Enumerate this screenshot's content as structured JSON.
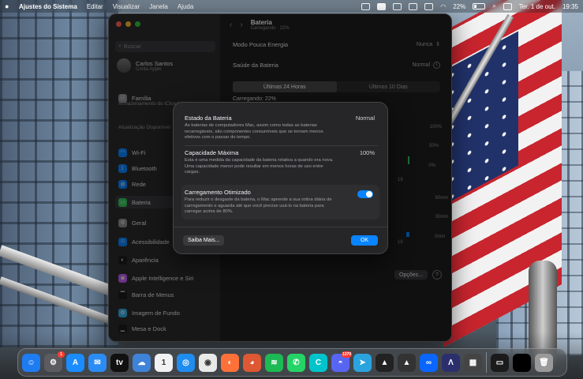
{
  "menubar": {
    "app_name": "Ajustes do Sistema",
    "menus": [
      "Editar",
      "Visualizar",
      "Janela",
      "Ajuda"
    ],
    "battery_percent": "22%",
    "date": "Ter. 1 de out.",
    "time": "19:35"
  },
  "window": {
    "search_placeholder": "Buscar",
    "profile_name": "Carlos Santos",
    "profile_sub": "Conta Apple",
    "family_label": "Família",
    "icloud_note": "Armazenamento do iCloud cheio",
    "update_note": "Atualização Disponível",
    "sidebar_items": [
      {
        "label": "Wi-Fi",
        "icon": "wifi-icon",
        "color": "#0a84ff"
      },
      {
        "label": "Bluetooth",
        "icon": "bluetooth-icon",
        "color": "#0a84ff"
      },
      {
        "label": "Rede",
        "icon": "globe-icon",
        "color": "#0a84ff"
      },
      {
        "label": "Bateria",
        "icon": "battery-icon",
        "color": "#34c759"
      },
      {
        "label": "Geral",
        "icon": "gear-icon",
        "color": "#8e8e93"
      },
      {
        "label": "Acessibilidade",
        "icon": "accessibility-icon",
        "color": "#0a84ff"
      },
      {
        "label": "Aparência",
        "icon": "appearance-icon",
        "color": "#1c1c1e"
      },
      {
        "label": "Apple Intelligence e Siri",
        "icon": "siri-icon",
        "color": "#bf5af2"
      },
      {
        "label": "Barra de Menus",
        "icon": "menubar-icon",
        "color": "#1c1c1e"
      },
      {
        "label": "Imagem de Fundo",
        "icon": "wallpaper-icon",
        "color": "#32ade6"
      },
      {
        "label": "Mesa e Dock",
        "icon": "dock-icon",
        "color": "#1c1c1e"
      }
    ],
    "page_title": "Bateria",
    "page_subtitle": "Carregando · 22%",
    "low_power_label": "Modo Pouca Energia",
    "low_power_value": "Nunca",
    "health_label": "Saúde da Bateria",
    "health_value": "Normal",
    "tabs": [
      "Últimas 24 Horas",
      "Últimos 10 Dias"
    ],
    "charging_label": "Carregando: 22%",
    "chart_percent_labels": [
      "100%",
      "50%",
      "0%"
    ],
    "chart_minute_labels": [
      "60min",
      "30min",
      "0min"
    ],
    "chart_hour_label": "18",
    "options_button": "Opções...",
    "help_button": "?"
  },
  "sheet": {
    "state_title": "Estado da Bateria",
    "state_value": "Normal",
    "state_desc": "As baterias de computadores Mac, assim como todas as baterias recarregáveis, são componentes consumíveis que se tornam menos efetivos com o passar do tempo.",
    "capacity_title": "Capacidade Máxima",
    "capacity_value": "100%",
    "capacity_desc": "Esta é uma medida da capacidade da bateria relativa a quando era nova. Uma capacidade menor pode resultar em menos horas de uso entre cargas.",
    "optimized_title": "Carregamento Otimizado",
    "optimized_desc": "Para reduzir o desgaste da bateria, o Mac aprende a sua rotina diária de carregamento e aguarda até que você precise usá-lo na bateria para carregar acima de 80%.",
    "optimized_on": true,
    "more_button": "Saiba Mais...",
    "ok_button": "OK"
  },
  "dock": {
    "apps": [
      {
        "name": "finder-icon",
        "glyph": "☺",
        "color": "#1e7cf2"
      },
      {
        "name": "system-settings-icon",
        "glyph": "⚙",
        "color": "#5b5b60",
        "badge": "1"
      },
      {
        "name": "app-store-icon",
        "glyph": "A",
        "color": "#1a8cff"
      },
      {
        "name": "mail-icon",
        "glyph": "✉",
        "color": "#2b8cf5"
      },
      {
        "name": "apple-tv-icon",
        "glyph": "tv",
        "color": "#111111"
      },
      {
        "name": "weather-icon",
        "glyph": "☁",
        "color": "#3f83d8"
      },
      {
        "name": "calendar-icon",
        "glyph": "1",
        "color": "#f2f2f2"
      },
      {
        "name": "safari-icon",
        "glyph": "◎",
        "color": "#1f8df0"
      },
      {
        "name": "chrome-icon",
        "glyph": "◉",
        "color": "#e9e9e9"
      },
      {
        "name": "firefox-icon",
        "glyph": "◐",
        "color": "#ff7139"
      },
      {
        "name": "duckduckgo-icon",
        "glyph": "◕",
        "color": "#de5833"
      },
      {
        "name": "spotify-icon",
        "glyph": "≋",
        "color": "#1db954"
      },
      {
        "name": "whatsapp-icon",
        "glyph": "✆",
        "color": "#25d366"
      },
      {
        "name": "canva-icon",
        "glyph": "C",
        "color": "#00c4cc"
      },
      {
        "name": "discord-icon",
        "glyph": "◓",
        "color": "#5865f2",
        "badge": "1379"
      },
      {
        "name": "telegram-icon",
        "glyph": "➤",
        "color": "#2aa3df"
      },
      {
        "name": "capcut-icon",
        "glyph": "▲",
        "color": "#222222"
      },
      {
        "name": "aptoide-icon",
        "glyph": "▲",
        "color": "#333333"
      },
      {
        "name": "meta-icon",
        "glyph": "∞",
        "color": "#0a66ff"
      },
      {
        "name": "affinity-icon",
        "glyph": "Λ",
        "color": "#2b2f6b"
      },
      {
        "name": "utilities-icon",
        "glyph": "▦",
        "color": "#444444"
      }
    ],
    "recent": [
      {
        "name": "recent-window-thumb",
        "glyph": "▭",
        "color": "#1b1b1b"
      },
      {
        "name": "recent-window-thumb-2",
        "glyph": "",
        "color": "#000000"
      },
      {
        "name": "trash-icon",
        "glyph": "🗑",
        "color": "#9a9a9a"
      }
    ]
  }
}
